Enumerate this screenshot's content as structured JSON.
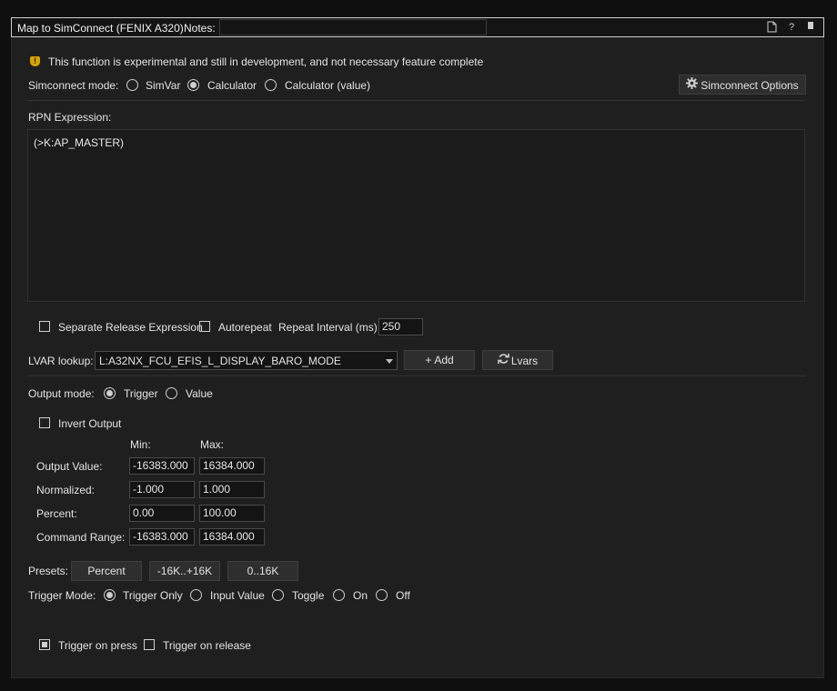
{
  "titlebar": {
    "title": "Map to SimConnect (FENIX A320)",
    "notes_label": "Notes:",
    "notes_value": "",
    "icons": [
      "document-icon",
      "help-icon",
      "pin-icon"
    ]
  },
  "warning": {
    "icon": "shield-warning-icon",
    "text": "This function is experimental and still in development, and not necessary feature complete"
  },
  "simconnect_mode": {
    "label": "Simconnect mode:",
    "options": [
      "SimVar",
      "Calculator",
      "Calculator (value)"
    ],
    "selected": "Calculator",
    "options_button": "Simconnect Options",
    "options_icon": "gear-icon"
  },
  "rpn": {
    "label": "RPN Expression:",
    "value": "(>K:AP_MASTER)"
  },
  "release": {
    "separate_label": "Separate Release Expression",
    "separate_checked": false,
    "autorepeat_label": "Autorepeat",
    "autorepeat_checked": false,
    "interval_label": "Repeat Interval (ms)",
    "interval_value": "250"
  },
  "lvar": {
    "label": "LVAR lookup:",
    "selected": "L:A32NX_FCU_EFIS_L_DISPLAY_BARO_MODE",
    "add_button": "Add",
    "add_icon": "plus-icon",
    "lvars_button": "Lvars",
    "lvars_icon": "refresh-icon"
  },
  "output_mode": {
    "label": "Output mode:",
    "options": [
      "Trigger",
      "Value"
    ],
    "selected": "Trigger",
    "invert_label": "Invert Output",
    "invert_checked": false
  },
  "ranges": {
    "min_header": "Min:",
    "max_header": "Max:",
    "rows": [
      {
        "label": "Output Value:",
        "min": "-16383.000",
        "max": "16384.000"
      },
      {
        "label": "Normalized:",
        "min": "-1.000",
        "max": "1.000"
      },
      {
        "label": "Percent:",
        "min": "0.00",
        "max": "100.00"
      },
      {
        "label": "Command Range:",
        "min": "-16383.000",
        "max": "16384.000"
      }
    ]
  },
  "presets": {
    "label": "Presets:",
    "buttons": [
      "Percent",
      "-16K..+16K",
      "0..16K"
    ]
  },
  "trigger_mode": {
    "label": "Trigger Mode:",
    "options": [
      "Trigger Only",
      "Input Value",
      "Toggle",
      "On",
      "Off"
    ],
    "selected": "Trigger Only"
  },
  "trigger_on": {
    "press_label": "Trigger on press",
    "press_checked": true,
    "release_label": "Trigger on release",
    "release_checked": false
  }
}
